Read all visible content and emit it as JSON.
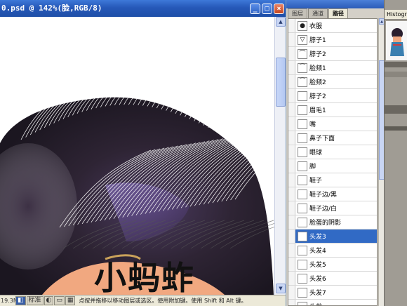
{
  "document": {
    "title": "0.psd @ 142%(脸,RGB/8)",
    "buttons": {
      "minimize": "_",
      "maximize": "□",
      "close": "×"
    },
    "watermark_text": "小蚂蚱"
  },
  "status": {
    "zoom": "19.3M",
    "mode_label": "标准",
    "hint": "点按并拖移以移动图层或选区。使用附加键。使用 Shift 和 Alt 键。"
  },
  "layers_panel": {
    "tabs": [
      "图层",
      "通道",
      "路径"
    ],
    "active_tab": 2,
    "layers": [
      {
        "name": "衣服",
        "icon": "●"
      },
      {
        "name": "脖子1",
        "icon": "▽"
      },
      {
        "name": "脖子2",
        "icon": "⌒"
      },
      {
        "name": "脸频1",
        "icon": "⁀"
      },
      {
        "name": "脸频2",
        "icon": "⁀"
      },
      {
        "name": "脖子2",
        "icon": ""
      },
      {
        "name": "眉毛1",
        "icon": ""
      },
      {
        "name": "嘴",
        "icon": ""
      },
      {
        "name": "鼻子下面",
        "icon": ""
      },
      {
        "name": "眼球",
        "icon": ""
      },
      {
        "name": "脚",
        "icon": ""
      },
      {
        "name": "鞋子",
        "icon": ""
      },
      {
        "name": "鞋子边/黑",
        "icon": ""
      },
      {
        "name": "鞋子边/白",
        "icon": ""
      },
      {
        "name": "脸蛋的阴影",
        "icon": ""
      },
      {
        "name": "头发3",
        "icon": "",
        "selected": true
      },
      {
        "name": "头发4",
        "icon": ""
      },
      {
        "name": "头发5",
        "icon": ""
      },
      {
        "name": "头发6",
        "icon": ""
      },
      {
        "name": "头发7",
        "icon": ""
      },
      {
        "name": "头发",
        "icon": ""
      }
    ]
  },
  "right_panel": {
    "histogram_label": "Histogra"
  },
  "colors": {
    "title_bar": "#2658b8",
    "selection": "#316ac5",
    "hair_dark": "#2a1f2e",
    "hair_purple": "#7a5fb8"
  }
}
